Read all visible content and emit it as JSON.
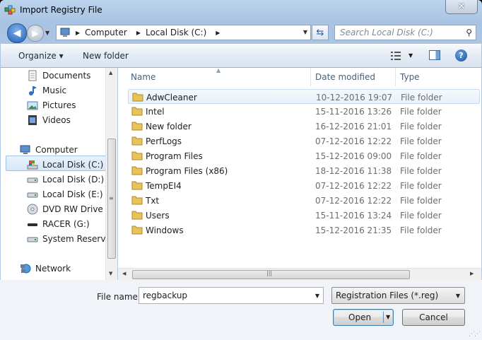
{
  "window": {
    "title": "Import Registry File",
    "close_glyph": "✕"
  },
  "address": {
    "crumbs": [
      "Computer",
      "Local Disk (C:)"
    ],
    "search_placeholder": "Search Local Disk (C:)"
  },
  "toolbar": {
    "organize_label": "Organize ▾",
    "new_folder_label": "New folder"
  },
  "nav": {
    "items": [
      {
        "label": "Documents",
        "icon": "documents-icon"
      },
      {
        "label": "Music",
        "icon": "music-icon"
      },
      {
        "label": "Pictures",
        "icon": "pictures-icon"
      },
      {
        "label": "Videos",
        "icon": "videos-icon"
      },
      {
        "label": "Computer",
        "icon": "computer-icon"
      },
      {
        "label": "Local Disk (C:)",
        "icon": "drive-icon",
        "selected": true
      },
      {
        "label": "Local Disk (D:)",
        "icon": "drive-icon"
      },
      {
        "label": "Local Disk (E:)",
        "icon": "drive-icon"
      },
      {
        "label": "DVD RW Drive (F:",
        "icon": "dvd-icon"
      },
      {
        "label": "RACER (G:)",
        "icon": "usb-drive-icon"
      },
      {
        "label": "System Reserved",
        "icon": "drive-icon"
      },
      {
        "label": "Network",
        "icon": "network-icon"
      }
    ]
  },
  "columns": {
    "name": "Name",
    "date": "Date modified",
    "type": "Type"
  },
  "files": [
    {
      "name": "AdwCleaner",
      "date": "10-12-2016 19:07",
      "type": "File folder"
    },
    {
      "name": "Intel",
      "date": "15-11-2016 13:26",
      "type": "File folder"
    },
    {
      "name": "New folder",
      "date": "16-12-2016 21:01",
      "type": "File folder"
    },
    {
      "name": "PerfLogs",
      "date": "07-12-2016 12:22",
      "type": "File folder"
    },
    {
      "name": "Program Files",
      "date": "15-12-2016 09:00",
      "type": "File folder"
    },
    {
      "name": "Program Files (x86)",
      "date": "18-12-2016 11:38",
      "type": "File folder"
    },
    {
      "name": "TempEI4",
      "date": "07-12-2016 12:22",
      "type": "File folder"
    },
    {
      "name": "Txt",
      "date": "07-12-2016 12:22",
      "type": "File folder"
    },
    {
      "name": "Users",
      "date": "15-11-2016 13:24",
      "type": "File folder"
    },
    {
      "name": "Windows",
      "date": "15-12-2016 21:35",
      "type": "File folder"
    }
  ],
  "footer": {
    "file_name_label": "File name:",
    "file_name_value": "regbackup",
    "file_type_value": "Registration Files (*.reg)",
    "open_label": "Open",
    "cancel_label": "Cancel"
  }
}
